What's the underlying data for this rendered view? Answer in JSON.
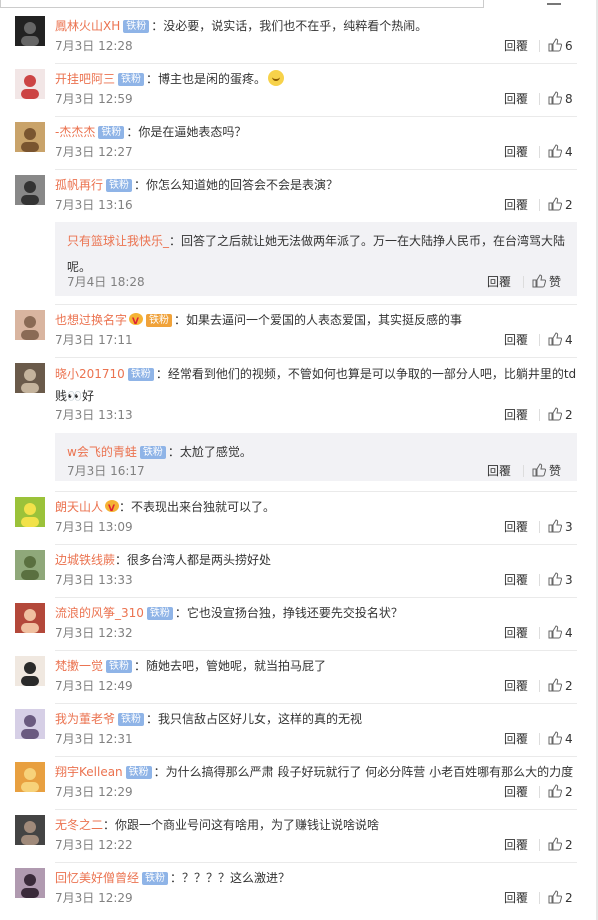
{
  "ui": {
    "reply_label": "回覆",
    "like_icon": "thumb-up-icon",
    "menu_icon": "hamburger-menu-icon",
    "accent_username": "#eb7350",
    "badge_color": "#8fb4e7"
  },
  "comments": [
    {
      "user": "鳳林火山XH",
      "badge": "铁粉",
      "text": "：没必要，说实话，我们也不在乎，纯粹看个热闹。",
      "time": "7月3日 12:28",
      "likes": "6"
    },
    {
      "user": "开挂吧阿三",
      "badge": "铁粉",
      "text": "：博主也是闲的蛋疼。",
      "emoji": "laughing-emoji",
      "time": "7月3日 12:59",
      "likes": "8"
    },
    {
      "user": "-杰杰杰",
      "badge": "铁粉",
      "text": "：你是在逼她表态吗？",
      "time": "7月3日 12:27",
      "likes": "4"
    },
    {
      "user": "孤帆再行",
      "badge": "铁粉",
      "text": "：你怎么知道她的回答会不会是表演？",
      "time": "7月3日 13:16",
      "likes": "2",
      "sub": {
        "user": "只有篮球让我快乐_",
        "text": "：回答了之后就让她无法做两年派了。万一在大陆挣人民币，在台湾骂大陆呢。",
        "time": "7月4日 18:28",
        "likes": "赞"
      }
    },
    {
      "user": "也想过换名字",
      "badge": "铁粉",
      "badge_gold": true,
      "vip": true,
      "text": "：如果去逼问一个爱国的人表态爱国，其实挺反感的事",
      "time": "7月3日 17:11",
      "likes": "4"
    },
    {
      "user": "晓小201710",
      "badge": "铁粉",
      "text": "：经常看到他们的视频，不管如何也算是可以争取的一部分人吧，比躺井里的td贱👀好",
      "time": "7月3日 13:13",
      "likes": "2",
      "sub": {
        "user": "w会飞的青蛙",
        "badge": "铁粉",
        "text": "：太尬了感觉。",
        "time": "7月3日 16:17",
        "likes": "赞"
      }
    },
    {
      "user": "朗天山人",
      "vip": true,
      "text": "：不表现出来台独就可以了。",
      "time": "7月3日 13:09",
      "likes": "3"
    },
    {
      "user": "边城铁线蕨",
      "text": "：很多台湾人都是两头捞好处",
      "time": "7月3日 13:33",
      "likes": "3"
    },
    {
      "user": "流浪的风筝_310",
      "badge": "铁粉",
      "text": "：它也没宣扬台独，挣钱还要先交投名状？",
      "time": "7月3日 12:32",
      "likes": "4"
    },
    {
      "user": "梵擻一觉",
      "badge": "铁粉",
      "text": "：随她去吧，管她呢，就当拍马屁了",
      "time": "7月3日 12:49",
      "likes": "2"
    },
    {
      "user": "我为董老爷",
      "badge": "铁粉",
      "text": "：我只信敌占区好儿女，这样的真的无视",
      "time": "7月3日 12:31",
      "likes": "4"
    },
    {
      "user": "翔宇Kellean",
      "badge": "铁粉",
      "text": "：为什么搞得那么严肃 段子好玩就行了 何必分阵营 小老百姓哪有那么大的力度",
      "time": "7月3日 12:29",
      "likes": "2"
    },
    {
      "user": "无冬之二",
      "text": "：你跟一个商业号问这有啥用，为了赚钱让说啥说啥",
      "time": "7月3日 12:22",
      "likes": "2"
    },
    {
      "user": "回忆美好僧曾经",
      "badge": "铁粉",
      "text": "：？？？？这么激进？",
      "time": "7月3日 12:29",
      "likes": "2"
    }
  ]
}
